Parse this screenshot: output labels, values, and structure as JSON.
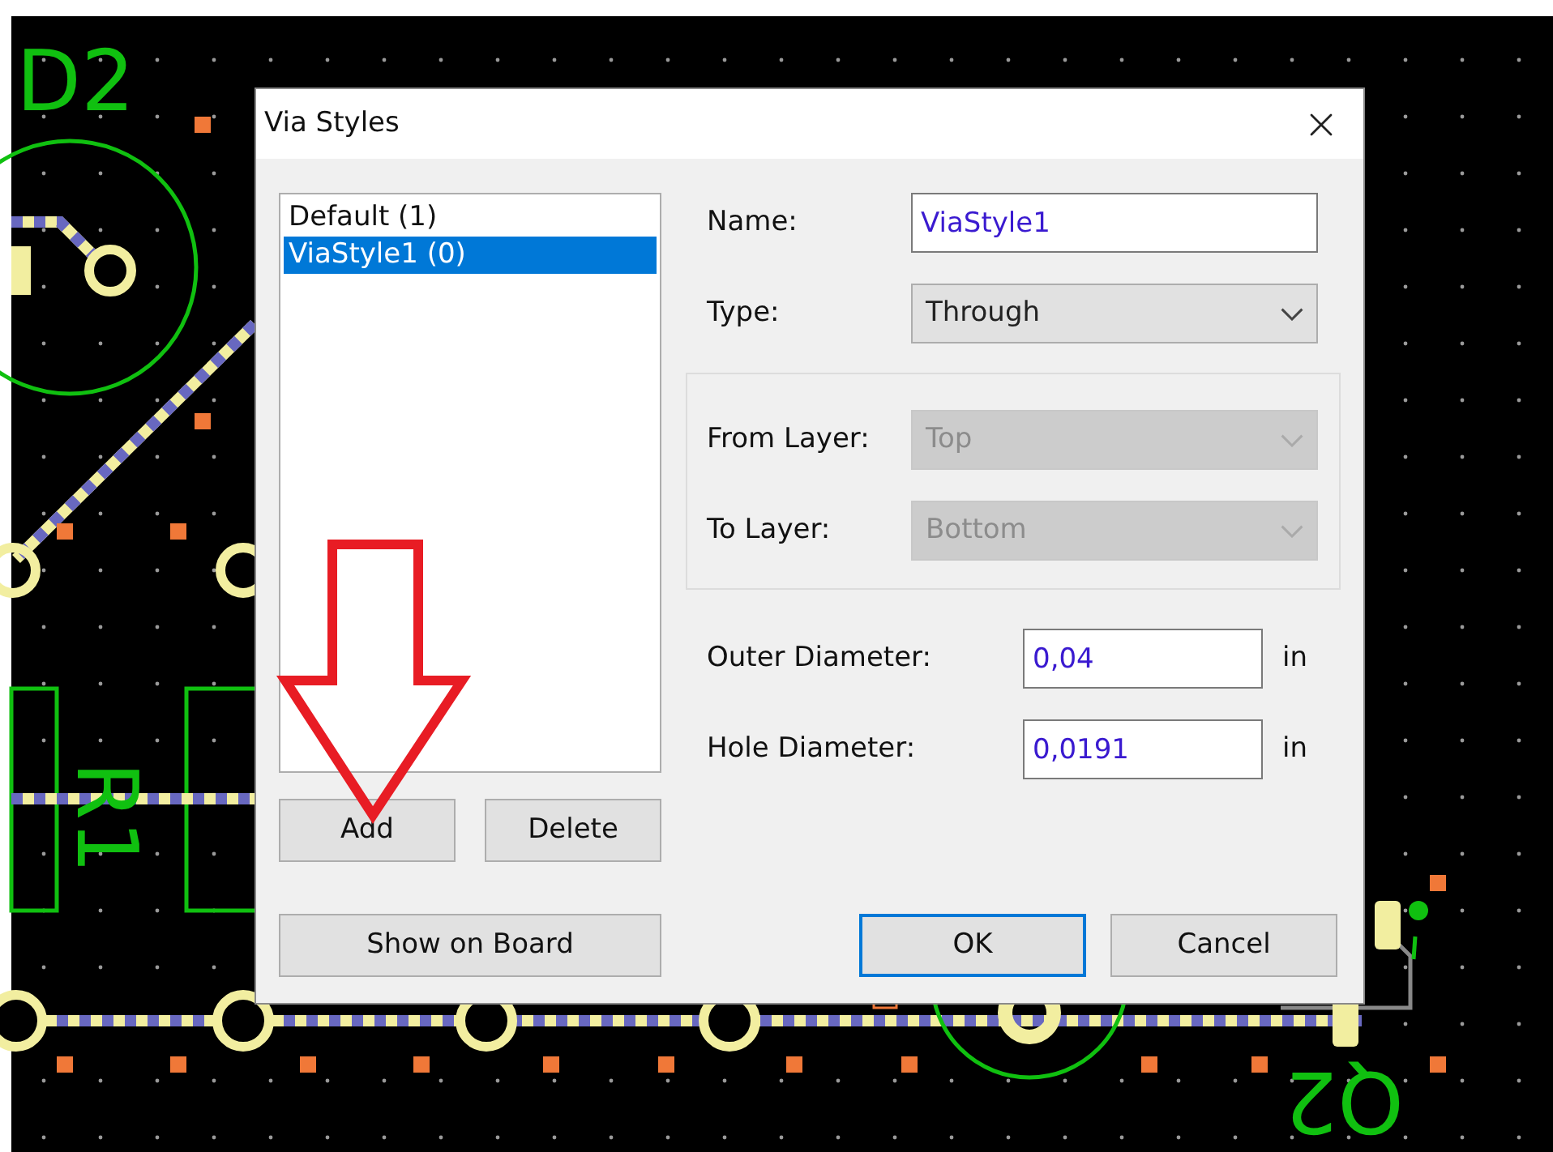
{
  "pcb": {
    "labels": [
      {
        "text": "D2",
        "kind": "upright"
      },
      {
        "text": "R1",
        "kind": "rotated"
      },
      {
        "text": "Q2",
        "kind": "flipped"
      }
    ]
  },
  "dialog": {
    "title": "Via Styles",
    "styles": [
      {
        "label": "Default (1)",
        "selected": false
      },
      {
        "label": "ViaStyle1 (0)",
        "selected": true
      }
    ],
    "list_buttons": [
      "Add",
      "Delete"
    ],
    "show_button": "Show on Board",
    "name": {
      "label": "Name:",
      "value": "ViaStyle1"
    },
    "type": {
      "label": "Type:",
      "value": "Through",
      "disabled": false
    },
    "layers": [
      {
        "label": "From Layer:",
        "value": "Top",
        "disabled": true
      },
      {
        "label": "To Layer:",
        "value": "Bottom",
        "disabled": true
      }
    ],
    "diameters": [
      {
        "label": "Outer Diameter:",
        "value": "0,04",
        "unit": "in"
      },
      {
        "label": "Hole Diameter:",
        "value": "0,0191",
        "unit": "in"
      }
    ],
    "buttons": [
      {
        "label": "OK",
        "default": true
      },
      {
        "label": "Cancel",
        "default": false
      }
    ]
  }
}
